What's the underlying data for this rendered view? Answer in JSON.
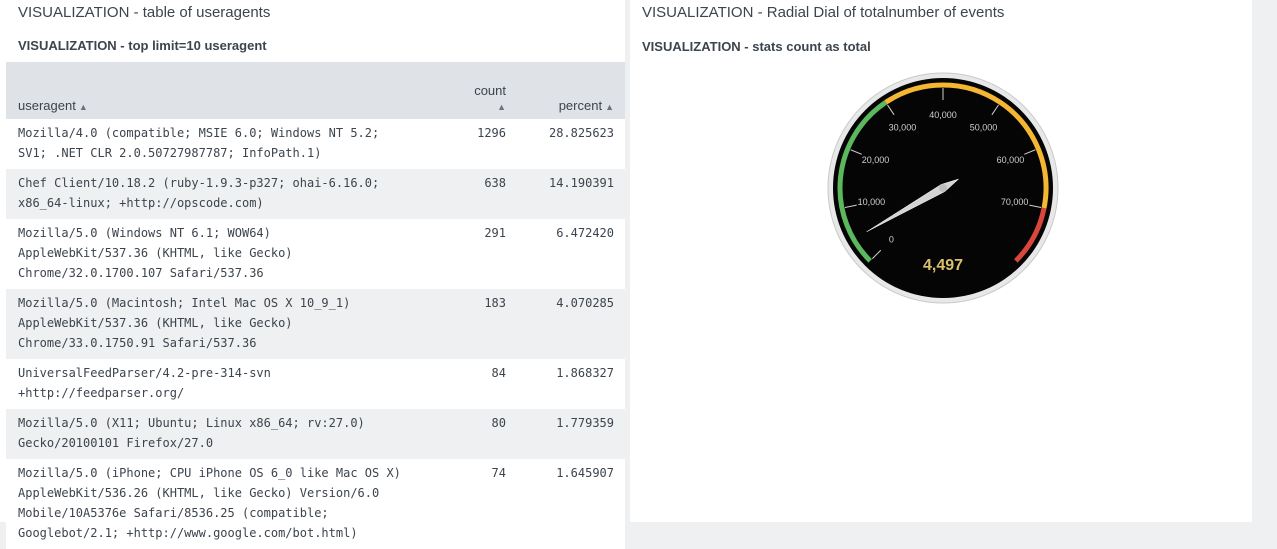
{
  "left_panel": {
    "title": "VISUALIZATION - table of useragents",
    "viz_title": "VISUALIZATION - top limit=10 useragent",
    "table": {
      "headers": {
        "useragent": "useragent",
        "count": "count",
        "percent": "percent"
      },
      "rows": [
        {
          "useragent": "Mozilla/4.0 (compatible; MSIE 6.0; Windows NT 5.2; SV1; .NET CLR 2.0.50727987787; InfoPath.1)",
          "count": "1296",
          "percent": "28.825623"
        },
        {
          "useragent": "Chef Client/10.18.2 (ruby-1.9.3-p327; ohai-6.16.0; x86_64-linux; +http://opscode.com)",
          "count": "638",
          "percent": "14.190391"
        },
        {
          "useragent": "Mozilla/5.0 (Windows NT 6.1; WOW64) AppleWebKit/537.36 (KHTML, like Gecko) Chrome/32.0.1700.107 Safari/537.36",
          "count": "291",
          "percent": "6.472420"
        },
        {
          "useragent": "Mozilla/5.0 (Macintosh; Intel Mac OS X 10_9_1) AppleWebKit/537.36 (KHTML, like Gecko) Chrome/33.0.1750.91 Safari/537.36",
          "count": "183",
          "percent": "4.070285"
        },
        {
          "useragent": "UniversalFeedParser/4.2-pre-314-svn +http://feedparser.org/",
          "count": "84",
          "percent": "1.868327"
        },
        {
          "useragent": "Mozilla/5.0 (X11; Ubuntu; Linux x86_64; rv:27.0) Gecko/20100101 Firefox/27.0",
          "count": "80",
          "percent": "1.779359"
        },
        {
          "useragent": "Mozilla/5.0 (iPhone; CPU iPhone OS 6_0 like Mac OS X) AppleWebKit/536.26 (KHTML, like Gecko) Version/6.0 Mobile/10A5376e Safari/8536.25 (compatible; Googlebot/2.1; +http://www.google.com/bot.html)",
          "count": "74",
          "percent": "1.645907"
        }
      ]
    }
  },
  "right_panel": {
    "title": "VISUALIZATION - Radial Dial of totalnumber of events",
    "viz_title": "VISUALIZATION - stats count as total",
    "gauge": {
      "value": 4497,
      "value_label": "4,497",
      "min": 0,
      "max": 80000,
      "tick_labels": [
        "0",
        "10,000",
        "20,000",
        "30,000",
        "40,000",
        "50,000",
        "60,000",
        "70,000"
      ],
      "tick_values": [
        0,
        10000,
        20000,
        30000,
        40000,
        50000,
        60000,
        70000
      ],
      "bands": [
        {
          "from": 0,
          "to": 30000,
          "color": "#5cb85c"
        },
        {
          "from": 30000,
          "to": 70000,
          "color": "#f5b731"
        },
        {
          "from": 70000,
          "to": 80000,
          "color": "#d9463c"
        }
      ],
      "value_color": "#d9c06b"
    }
  }
}
